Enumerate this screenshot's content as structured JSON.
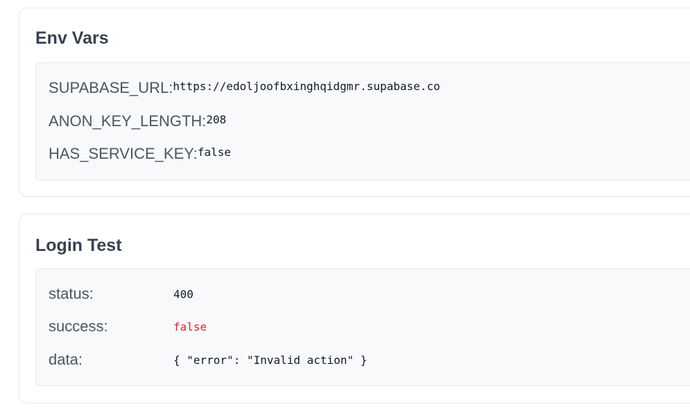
{
  "env_vars": {
    "title": "Env Vars",
    "rows": [
      {
        "label": "SUPABASE_URL:",
        "value": "https://edoljoofbxinghqidgmr.supabase.co"
      },
      {
        "label": "ANON_KEY_LENGTH:",
        "value": "208"
      },
      {
        "label": "HAS_SERVICE_KEY:",
        "value": "false"
      }
    ]
  },
  "login_test": {
    "title": "Login Test",
    "rows": [
      {
        "label": "status:",
        "value": "400"
      },
      {
        "label": "success:",
        "value": "false"
      },
      {
        "label": "data:",
        "value": "{ \"error\": \"Invalid action\" }"
      }
    ],
    "colors": {
      "false_value": "#dc2626"
    }
  }
}
